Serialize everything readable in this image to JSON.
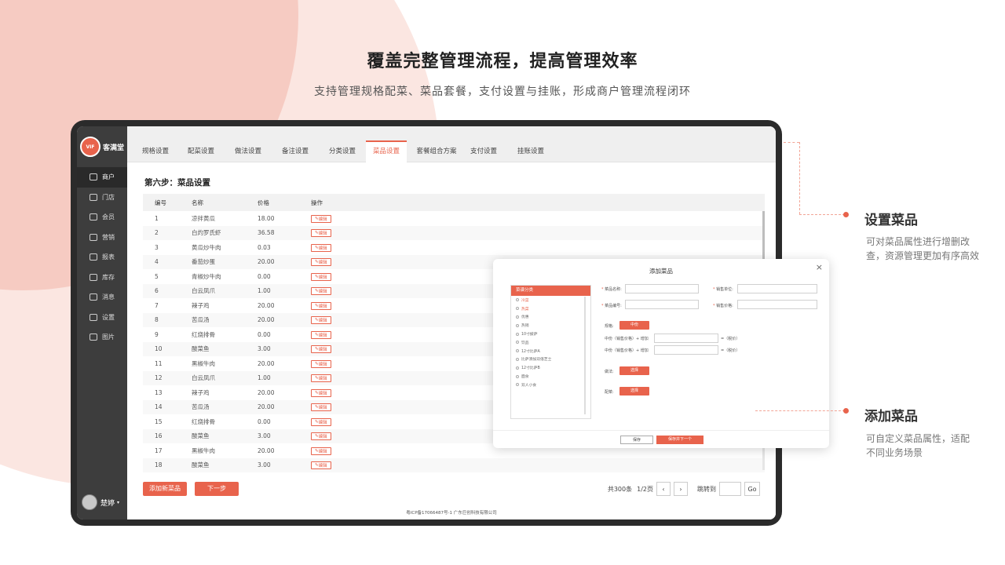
{
  "page": {
    "headline": "覆盖完整管理流程，提高管理效率",
    "subline": "支持管理规格配菜、菜品套餐，支付设置与挂账，形成商户管理流程闭环"
  },
  "brand": {
    "logo_mark": "VIF",
    "logo_text": "客满堂",
    "accent": "#e8634c"
  },
  "sidebar": {
    "items": [
      {
        "label": "商户",
        "icon": "store-icon"
      },
      {
        "label": "门店",
        "icon": "shop-icon"
      },
      {
        "label": "会员",
        "icon": "crown-icon"
      },
      {
        "label": "营销",
        "icon": "chart-icon"
      },
      {
        "label": "报表",
        "icon": "report-icon"
      },
      {
        "label": "库存",
        "icon": "inventory-icon"
      },
      {
        "label": "消息",
        "icon": "bell-icon"
      },
      {
        "label": "设置",
        "icon": "gear-icon"
      },
      {
        "label": "图片",
        "icon": "image-icon"
      }
    ],
    "user": {
      "name": "楚婷",
      "caret": "▾"
    }
  },
  "tabs": [
    "规格设置",
    "配菜设置",
    "做法设置",
    "备注设置",
    "分类设置",
    "菜品设置",
    "套餐组合方案",
    "支付设置",
    "挂账设置"
  ],
  "step_title": "第六步：菜品设置",
  "table": {
    "headers": [
      "编号",
      "名称",
      "价格",
      "操作"
    ],
    "edit_label": "编辑",
    "rows": [
      [
        "1",
        "凉拌黄瓜",
        "18.00"
      ],
      [
        "2",
        "白灼罗氏虾",
        "36.58"
      ],
      [
        "3",
        "黄瓜炒牛肉",
        "0.03"
      ],
      [
        "4",
        "番茄炒蛋",
        "20.00"
      ],
      [
        "5",
        "青椒炒牛肉",
        "0.00"
      ],
      [
        "6",
        "白云凤爪",
        "1.00"
      ],
      [
        "7",
        "辣子鸡",
        "20.00"
      ],
      [
        "8",
        "苦瓜汤",
        "20.00"
      ],
      [
        "9",
        "红烧排骨",
        "0.00"
      ],
      [
        "10",
        "酸菜鱼",
        "3.00"
      ],
      [
        "11",
        "黑椒牛肉",
        "20.00"
      ],
      [
        "12",
        "白云凤爪",
        "1.00"
      ],
      [
        "13",
        "辣子鸡",
        "20.00"
      ],
      [
        "14",
        "苦瓜汤",
        "20.00"
      ],
      [
        "15",
        "红烧排骨",
        "0.00"
      ],
      [
        "16",
        "酸菜鱼",
        "3.00"
      ],
      [
        "17",
        "黑椒牛肉",
        "20.00"
      ],
      [
        "18",
        "酸菜鱼",
        "3.00"
      ]
    ]
  },
  "actions": {
    "add": "添加新菜品",
    "next": "下一步"
  },
  "pager": {
    "summary": "共300条",
    "page": "1/2页",
    "prev": "‹",
    "next": "›",
    "jump": "跳转到",
    "go": "Go"
  },
  "footer": "粤ICP备17066487号-1 广东巨创科技有限公司",
  "modal": {
    "title": "添加菜品",
    "close": "×",
    "category_head": "菜谱分类",
    "categories": [
      "冷菜",
      "热菜",
      "优惠",
      "热销",
      "10寸披萨",
      "饮品",
      "12寸比萨A",
      "比萨添加双倍芝士",
      "12寸比萨B",
      "面食",
      "双人小食"
    ],
    "fields": {
      "name": "菜品名称:",
      "unit": "销售单位:",
      "code": "菜品编号:",
      "price": "销售价格:"
    },
    "spec_label": "规格:",
    "spec_value": "中份",
    "price_rows": [
      {
        "label": "中份（销售价格）+ 增加",
        "suffix": "=（税价）"
      },
      {
        "label": "中份（销售价格）+ 增加",
        "suffix": "=（税价）"
      }
    ],
    "method_label": "做法:",
    "side_label": "配菜:",
    "choose": "选择",
    "save": "保存",
    "save_next": "保存并下一个"
  },
  "callouts": [
    {
      "title": "设置菜品",
      "desc_1": "可对菜品属性进行增删改",
      "desc_2": "查，资源管理更加有序高效"
    },
    {
      "title": "添加菜品",
      "desc_1": "可自定义菜品属性，适配",
      "desc_2": "不同业务场景"
    }
  ]
}
